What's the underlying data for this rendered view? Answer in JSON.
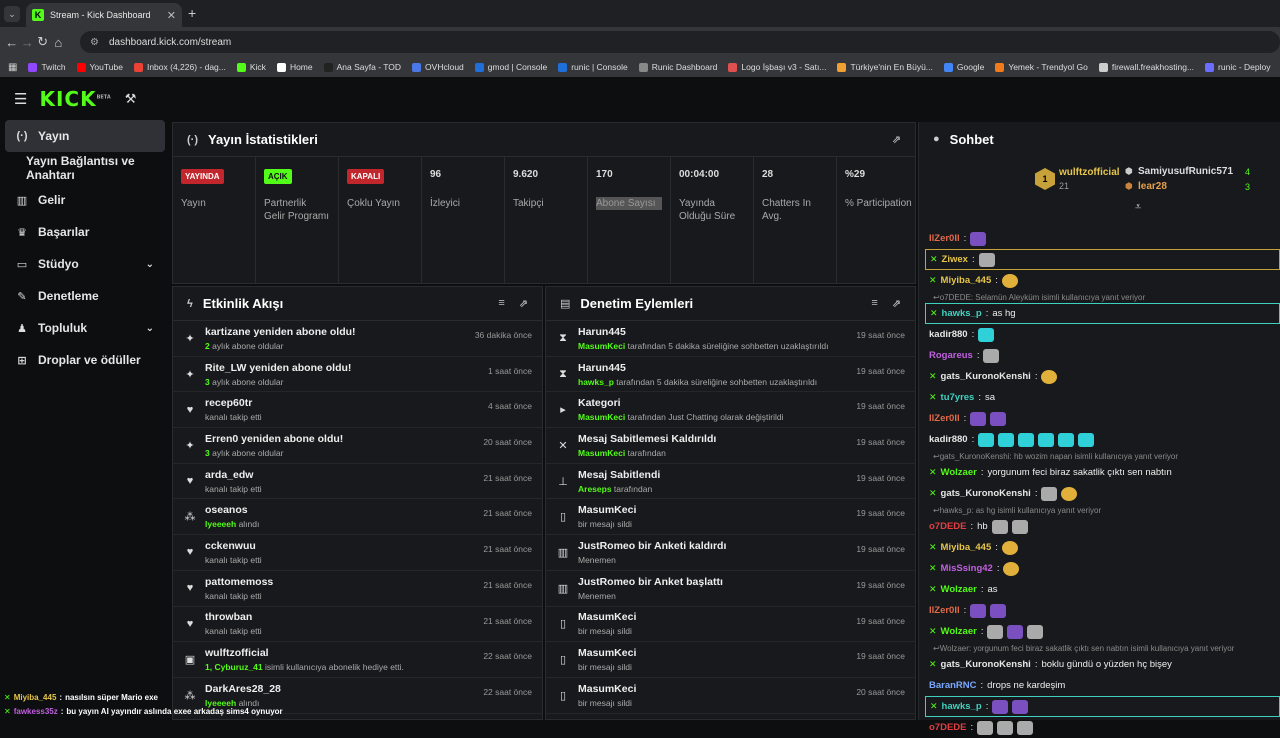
{
  "browser": {
    "tab_title": "Stream - Kick Dashboard",
    "url": "dashboard.kick.com/stream",
    "bookmarks": [
      {
        "label": "Twitch",
        "color": "#9146ff"
      },
      {
        "label": "YouTube",
        "color": "#ff0000"
      },
      {
        "label": "Inbox (4,226) - dag...",
        "color": "#ea4335"
      },
      {
        "label": "Kick",
        "color": "#53fc18"
      },
      {
        "label": "Home",
        "color": "#ffffff"
      },
      {
        "label": "Ana Sayfa - TOD",
        "color": "#222222"
      },
      {
        "label": "OVHcloud",
        "color": "#4a78e8"
      },
      {
        "label": "gmod | Console",
        "color": "#1e6fd9"
      },
      {
        "label": "runic | Console",
        "color": "#1e6fd9"
      },
      {
        "label": "Runic Dashboard",
        "color": "#888888"
      },
      {
        "label": "Logo İşbaşı v3 - Satı...",
        "color": "#e05050"
      },
      {
        "label": "Türkiye'nin En Büyü...",
        "color": "#f0a030"
      },
      {
        "label": "Google",
        "color": "#4285f4"
      },
      {
        "label": "Yemek - Trendyol Go",
        "color": "#f27a1a"
      },
      {
        "label": "firewall.freakhosting...",
        "color": "#cccccc"
      },
      {
        "label": "runic - Deploy",
        "color": "#6c6cff"
      }
    ]
  },
  "app": {
    "logo": "KICK",
    "logo_sup": "BETA"
  },
  "sidebar": {
    "items": [
      {
        "label": "Yayın",
        "icon": "broadcast-icon"
      },
      {
        "label": "Yayın Bağlantısı ve Anahtarı",
        "icon": ""
      },
      {
        "label": "Gelir",
        "icon": "revenue-icon"
      },
      {
        "label": "Başarılar",
        "icon": "trophy-icon"
      },
      {
        "label": "Stüdyo",
        "icon": "studio-icon"
      },
      {
        "label": "Denetleme",
        "icon": "wrench-icon"
      },
      {
        "label": "Topluluk",
        "icon": "community-icon"
      },
      {
        "label": "Droplar ve ödüller",
        "icon": "drops-icon"
      }
    ]
  },
  "stats": {
    "title": "Yayın İstatistikleri",
    "cards": [
      {
        "value": "YAYINDA",
        "label": "Yayın",
        "kind": "red"
      },
      {
        "value": "AÇIK",
        "label": "Partnerlik Gelir Programı",
        "kind": "green"
      },
      {
        "value": "KAPALI",
        "label": "Çoklu Yayın",
        "kind": "red"
      },
      {
        "value": "96",
        "label": "İzleyici",
        "kind": "text"
      },
      {
        "value": "9.620",
        "label": "Takipçi",
        "kind": "text"
      },
      {
        "value": "170",
        "label": "Abone Sayısı",
        "kind": "text"
      },
      {
        "value": "00:04:00",
        "label": "Yayında Olduğu Süre",
        "kind": "text"
      },
      {
        "value": "28",
        "label": "Chatters In Avg.",
        "kind": "text"
      },
      {
        "value": "%29",
        "label": "% Participation",
        "kind": "text"
      }
    ]
  },
  "activity": {
    "title": "Etkinlik Akışı",
    "items": [
      {
        "icon": "sparkle-icon",
        "title": "kartizane yeniden abone oldu!",
        "hl": "2",
        "sub": " aylık abone oldular",
        "time": "36 dakika önce"
      },
      {
        "icon": "sparkle-icon",
        "title": "Rite_LW yeniden abone oldu!",
        "hl": "3",
        "sub": " aylık abone oldular",
        "time": "1 saat önce"
      },
      {
        "icon": "heart-icon",
        "title": "recep60tr",
        "hl": "",
        "sub": "kanalı takip etti",
        "time": "4 saat önce"
      },
      {
        "icon": "sparkle-icon",
        "title": "Erren0 yeniden abone oldu!",
        "hl": "3",
        "sub": " aylık abone oldular",
        "time": "20 saat önce"
      },
      {
        "icon": "heart-icon",
        "title": "arda_edw",
        "hl": "",
        "sub": "kanalı takip etti",
        "time": "21 saat önce"
      },
      {
        "icon": "drop-icon",
        "title": "oseanos",
        "hl": "lyeeeeh",
        "sub": " alındı",
        "time": "21 saat önce"
      },
      {
        "icon": "heart-icon",
        "title": "cckenwuu",
        "hl": "",
        "sub": "kanalı takip etti",
        "time": "21 saat önce"
      },
      {
        "icon": "heart-icon",
        "title": "pattomemoss",
        "hl": "",
        "sub": "kanalı takip etti",
        "time": "21 saat önce"
      },
      {
        "icon": "heart-icon",
        "title": "throwban",
        "hl": "",
        "sub": "kanalı takip etti",
        "time": "21 saat önce"
      },
      {
        "icon": "gift-icon",
        "title": "wulftzofficial",
        "hl": "1, Cyburuz_41",
        "sub": " isimli kullanıcıya abonelik hediye etti.",
        "time": "22 saat önce"
      },
      {
        "icon": "drop-icon",
        "title": "DarkAres28_28",
        "hl": "lyeeeeh",
        "sub": " alındı",
        "time": "22 saat önce"
      }
    ]
  },
  "moderation": {
    "title": "Denetim Eylemleri",
    "items": [
      {
        "icon": "hourglass-icon",
        "title": "Harun445",
        "hl": "MasumKeci",
        "sub": " tarafından 5 dakika süreliğine sohbetten uzaklaştırıldı",
        "time": "19 saat önce"
      },
      {
        "icon": "hourglass-icon",
        "title": "Harun445",
        "hl": "hawks_p",
        "sub": " tarafından 5 dakika süreliğine sohbetten uzaklaştırıldı",
        "time": "19 saat önce"
      },
      {
        "icon": "category-icon",
        "title": "Kategori",
        "hl": "MasumKeci",
        "sub": " tarafından Just Chatting olarak değiştirildi",
        "time": "19 saat önce"
      },
      {
        "icon": "unpin-icon",
        "title": "Mesaj Sabitlemesi Kaldırıldı",
        "hl": "MasumKeci",
        "sub": " tarafından",
        "time": "19 saat önce"
      },
      {
        "icon": "pin-icon",
        "title": "Mesaj Sabitlendi",
        "hl": "Areseps",
        "sub": " tarafından",
        "time": "19 saat önce"
      },
      {
        "icon": "trash-icon",
        "title": "MasumKeci",
        "hl": "",
        "sub": "bir mesajı sildi",
        "time": "19 saat önce"
      },
      {
        "icon": "poll-icon",
        "title": "JustRomeo bir Anketi kaldırdı",
        "hl": "",
        "sub": "Menemen",
        "time": "19 saat önce"
      },
      {
        "icon": "poll-icon",
        "title": "JustRomeo bir Anket başlattı",
        "hl": "",
        "sub": "Menemen",
        "time": "19 saat önce"
      },
      {
        "icon": "trash-icon",
        "title": "MasumKeci",
        "hl": "",
        "sub": "bir mesajı sildi",
        "time": "19 saat önce"
      },
      {
        "icon": "trash-icon",
        "title": "MasumKeci",
        "hl": "",
        "sub": "bir mesajı sildi",
        "time": "19 saat önce"
      },
      {
        "icon": "trash-icon",
        "title": "MasumKeci",
        "hl": "",
        "sub": "bir mesajı sildi",
        "time": "20 saat önce"
      }
    ]
  },
  "chat": {
    "title": "Sohbet",
    "top": [
      {
        "name": "wulftzofficial",
        "count": "21"
      },
      {
        "name": "SamiyusufRunic571",
        "count": "4"
      },
      {
        "name": "lear28",
        "count": "3"
      }
    ],
    "messages": [
      {
        "type": "msg",
        "user": "IlZer0Il",
        "color": "#e06a4a",
        "text": "",
        "emotes": [
          "p"
        ],
        "sub": false
      },
      {
        "type": "msg",
        "user": "Ziwex",
        "color": "#e6c64a",
        "text": "",
        "emotes": [
          "s"
        ],
        "sub": true,
        "box": "gold"
      },
      {
        "type": "msg",
        "user": "Miyiba_445",
        "color": "#e6c64a",
        "text": "",
        "emotes": [
          "y"
        ],
        "sub": true
      },
      {
        "type": "reply",
        "text": "o7DEDE: Selamün Aleyküm isimli kullanıcıya yanıt veriyor"
      },
      {
        "type": "msg",
        "user": "hawks_p",
        "color": "#3fd1c0",
        "text": "as hg",
        "emotes": [],
        "sub": true,
        "box": "teal"
      },
      {
        "type": "msg",
        "user": "kadir880",
        "color": "#e6e6e6",
        "text": "",
        "emotes": [
          "c"
        ],
        "sub": false
      },
      {
        "type": "msg",
        "user": "Rogareus",
        "color": "#c060e0",
        "text": "",
        "emotes": [
          "s"
        ],
        "sub": false
      },
      {
        "type": "msg",
        "user": "gats_KuronoKenshi",
        "color": "#e6e6e6",
        "text": "",
        "emotes": [
          "y"
        ],
        "sub": true
      },
      {
        "type": "msg",
        "user": "tu7yres",
        "color": "#3fd1c0",
        "text": "sa",
        "emotes": [],
        "sub": true
      },
      {
        "type": "msg",
        "user": "IlZer0Il",
        "color": "#e06a4a",
        "text": "",
        "emotes": [
          "p",
          "p"
        ],
        "sub": false
      },
      {
        "type": "msg",
        "user": "kadir880",
        "color": "#e6e6e6",
        "text": "",
        "emotes": [
          "c",
          "c",
          "c",
          "c",
          "c",
          "c"
        ],
        "sub": false
      },
      {
        "type": "reply",
        "text": "gats_KuronoKenshi: hb wozim napan isimli kullanıcıya yanıt veriyor"
      },
      {
        "type": "msg",
        "user": "Wolzaer",
        "color": "#53fc18",
        "text": "yorgunum feci biraz sakatlik çıktı sen nabtın",
        "emotes": [],
        "sub": true
      },
      {
        "type": "msg",
        "user": "gats_KuronoKenshi",
        "color": "#e6e6e6",
        "text": "",
        "emotes": [
          "s",
          "y"
        ],
        "sub": true
      },
      {
        "type": "reply",
        "text": "hawks_p: as hg isimli kullanıcıya yanıt veriyor"
      },
      {
        "type": "msg",
        "user": "o7DEDE",
        "color": "#e04040",
        "text": "hb",
        "emotes": [
          "s",
          "s"
        ],
        "sub": false
      },
      {
        "type": "msg",
        "user": "Miyiba_445",
        "color": "#e6c64a",
        "text": "",
        "emotes": [
          "y"
        ],
        "sub": true
      },
      {
        "type": "msg",
        "user": "MisSsing42",
        "color": "#c060e0",
        "text": "",
        "emotes": [
          "y"
        ],
        "sub": true
      },
      {
        "type": "msg",
        "user": "Wolzaer",
        "color": "#53fc18",
        "text": "as",
        "emotes": [],
        "sub": true
      },
      {
        "type": "msg",
        "user": "IlZer0Il",
        "color": "#e06a4a",
        "text": "",
        "emotes": [
          "p",
          "p"
        ],
        "sub": false
      },
      {
        "type": "msg",
        "user": "Wolzaer",
        "color": "#53fc18",
        "text": "",
        "emotes": [
          "s",
          "p",
          "s"
        ],
        "sub": true
      },
      {
        "type": "reply",
        "text": "Wolzaer: yorgunum feci biraz sakatlik çıktı sen nabtın isimli kullanıcıya yanıt veriyor"
      },
      {
        "type": "msg",
        "user": "gats_KuronoKenshi",
        "color": "#e6e6e6",
        "text": "boklu gündü o yüzden hç bişey",
        "emotes": [],
        "sub": true
      },
      {
        "type": "msg",
        "user": "BaranRNC",
        "color": "#7aa8ff",
        "text": "drops ne kardeşim",
        "emotes": [],
        "sub": false
      },
      {
        "type": "msg",
        "user": "hawks_p",
        "color": "#3fd1c0",
        "text": "",
        "emotes": [
          "p",
          "p"
        ],
        "sub": true,
        "box": "teal"
      },
      {
        "type": "msg",
        "user": "o7DEDE",
        "color": "#e04040",
        "text": "",
        "emotes": [
          "s",
          "s",
          "s"
        ],
        "sub": false
      }
    ]
  },
  "overlay": [
    {
      "user": "Miyiba_445",
      "color": "#e6c64a",
      "text": "nasılsın süper Mario exe"
    },
    {
      "user": "fawkess35z",
      "color": "#c060e0",
      "text": "bu yayın AI yayındır aslında exee arkadaş sims4 oynuyor"
    }
  ]
}
